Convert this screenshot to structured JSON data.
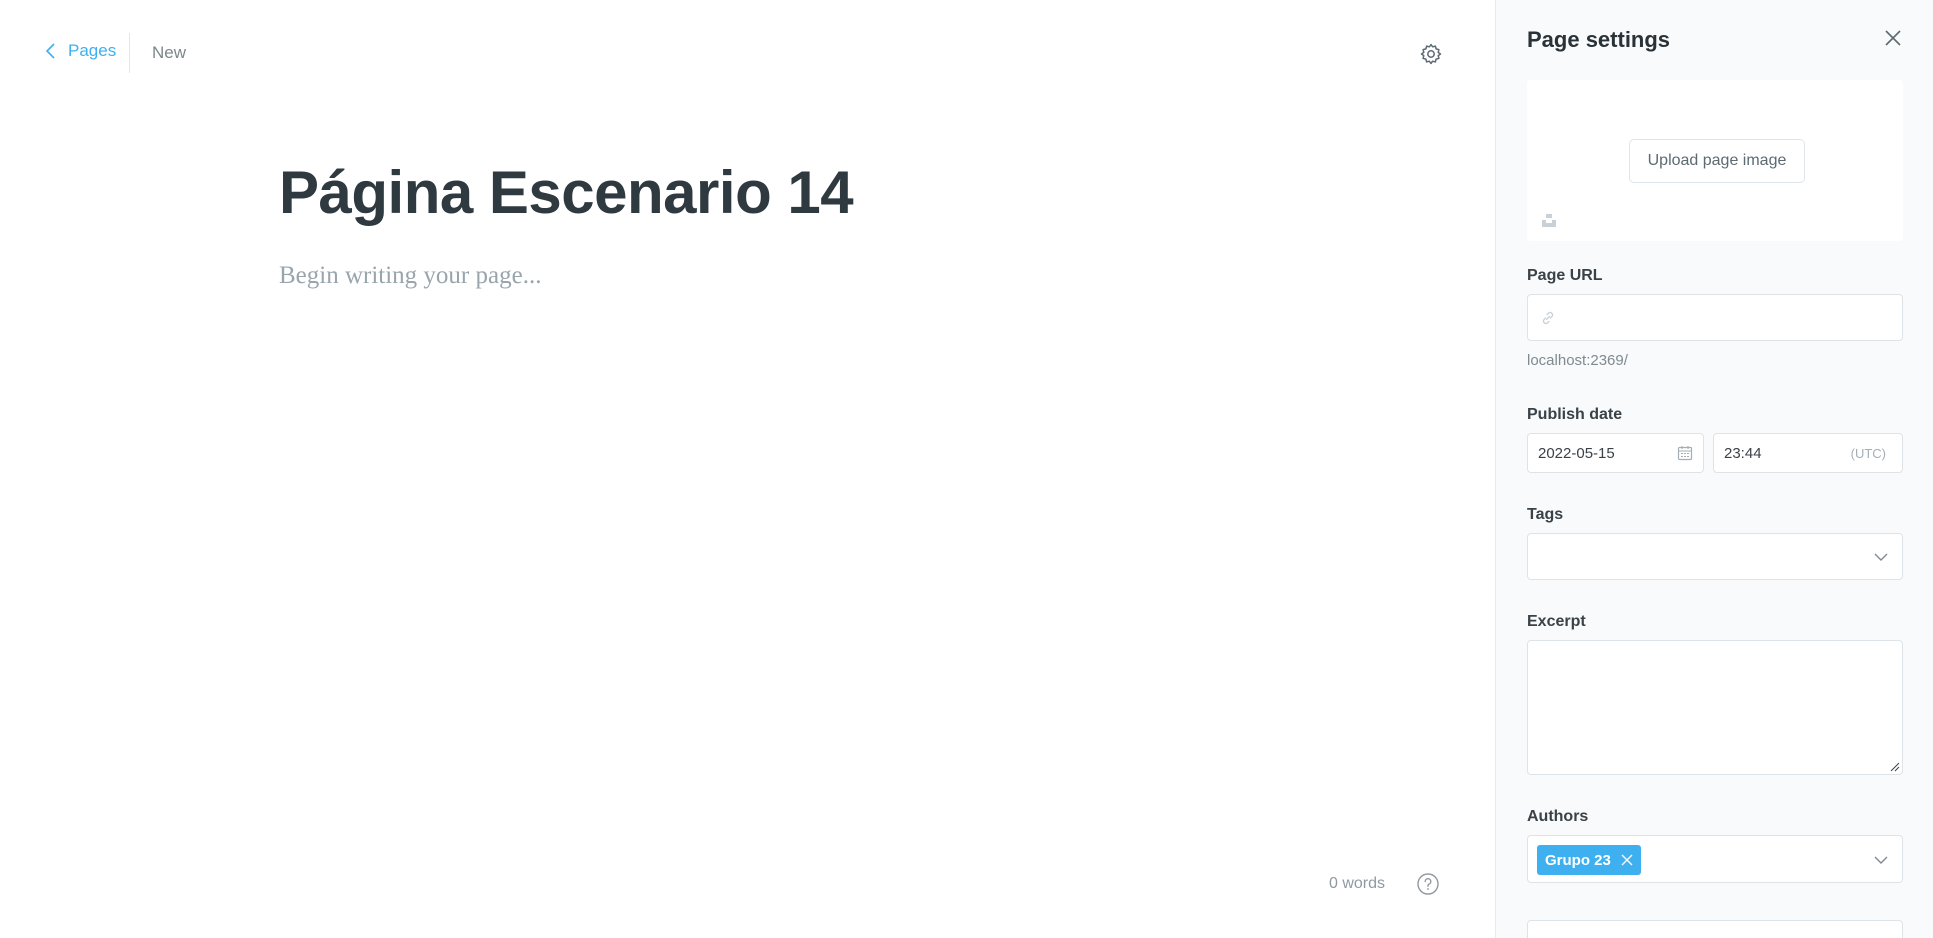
{
  "header": {
    "back_label": "Pages",
    "status": "New"
  },
  "editor": {
    "title": "Página Escenario 14",
    "body_placeholder": "Begin writing your page...",
    "word_count": "0 words"
  },
  "settings": {
    "title": "Page settings",
    "upload_label": "Upload page image",
    "page_url": {
      "label": "Page URL",
      "value": "",
      "help": "localhost:2369/"
    },
    "publish_date": {
      "label": "Publish date",
      "date": "2022-05-15",
      "time": "23:44",
      "timezone": "(UTC)"
    },
    "tags": {
      "label": "Tags"
    },
    "excerpt": {
      "label": "Excerpt",
      "value": ""
    },
    "authors": {
      "label": "Authors",
      "items": [
        "Grupo 23"
      ]
    }
  },
  "colors": {
    "accent": "#3eb0ef",
    "title": "#2f3a40",
    "panel_bg": "#f9fafb"
  }
}
